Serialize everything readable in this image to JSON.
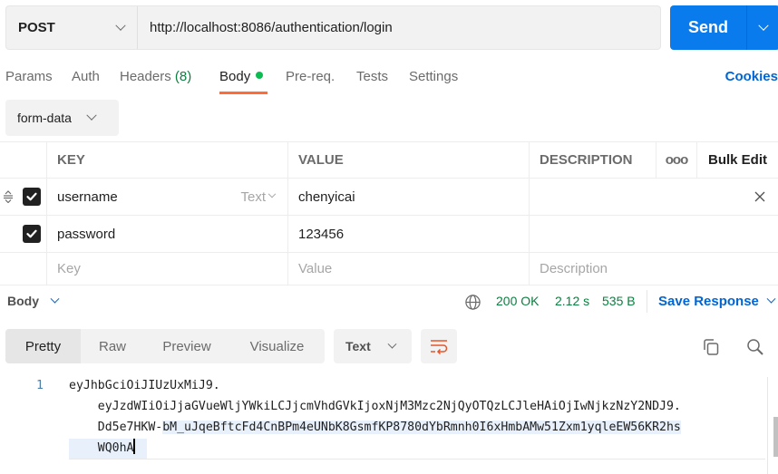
{
  "request": {
    "method": "POST",
    "url": "http://localhost:8086/authentication/login",
    "send_label": "Send"
  },
  "tabs": [
    {
      "label": "Params"
    },
    {
      "label": "Auth"
    },
    {
      "label": "Headers",
      "count": "(8)"
    },
    {
      "label": "Body",
      "active": true
    },
    {
      "label": "Pre-req."
    },
    {
      "label": "Tests"
    },
    {
      "label": "Settings"
    }
  ],
  "cookies_label": "Cookies",
  "body_type": "form-data",
  "table": {
    "headers": {
      "key": "KEY",
      "value": "VALUE",
      "description": "DESCRIPTION",
      "more": "ooo",
      "bulk_edit": "Bulk Edit"
    },
    "rows": [
      {
        "key": "username",
        "value": "chenyicai",
        "type": "Text",
        "checked": true
      },
      {
        "key": "password",
        "value": "123456",
        "checked": true
      }
    ],
    "placeholders": {
      "key": "Key",
      "value": "Value",
      "description": "Description"
    }
  },
  "response": {
    "section_label": "Body",
    "status": "200 OK",
    "time": "2.12 s",
    "size": "535 B",
    "save_label": "Save Response",
    "views": [
      "Pretty",
      "Raw",
      "Preview",
      "Visualize"
    ],
    "active_view": "Pretty",
    "format": "Text",
    "code": {
      "line_number": "1",
      "lines": [
        "eyJhbGciOiJIUzUxMiJ9.",
        "    eyJzdWIiOiJjaGVueWljYWkiLCJjcmVhdGVkIjoxNjM3Mzc2NjQyOTQzLCJleHAiOjIwNjkzNzY2NDJ9.",
        "    Dd5e7HKW-",
        "bM_uJqeBftcFd4CnBPm4eUNbK8GsmfKP8780dYbRmnh0I6xHmbAMw51Zxm1yqleEW56KR2hs",
        "    WQ0hA"
      ]
    }
  },
  "colors": {
    "accent": "#097bed",
    "link": "#0265d2",
    "active_tab_underline": "#ff6c37",
    "status_green": "#0a7f3f",
    "dot_green": "#0cbb52"
  }
}
